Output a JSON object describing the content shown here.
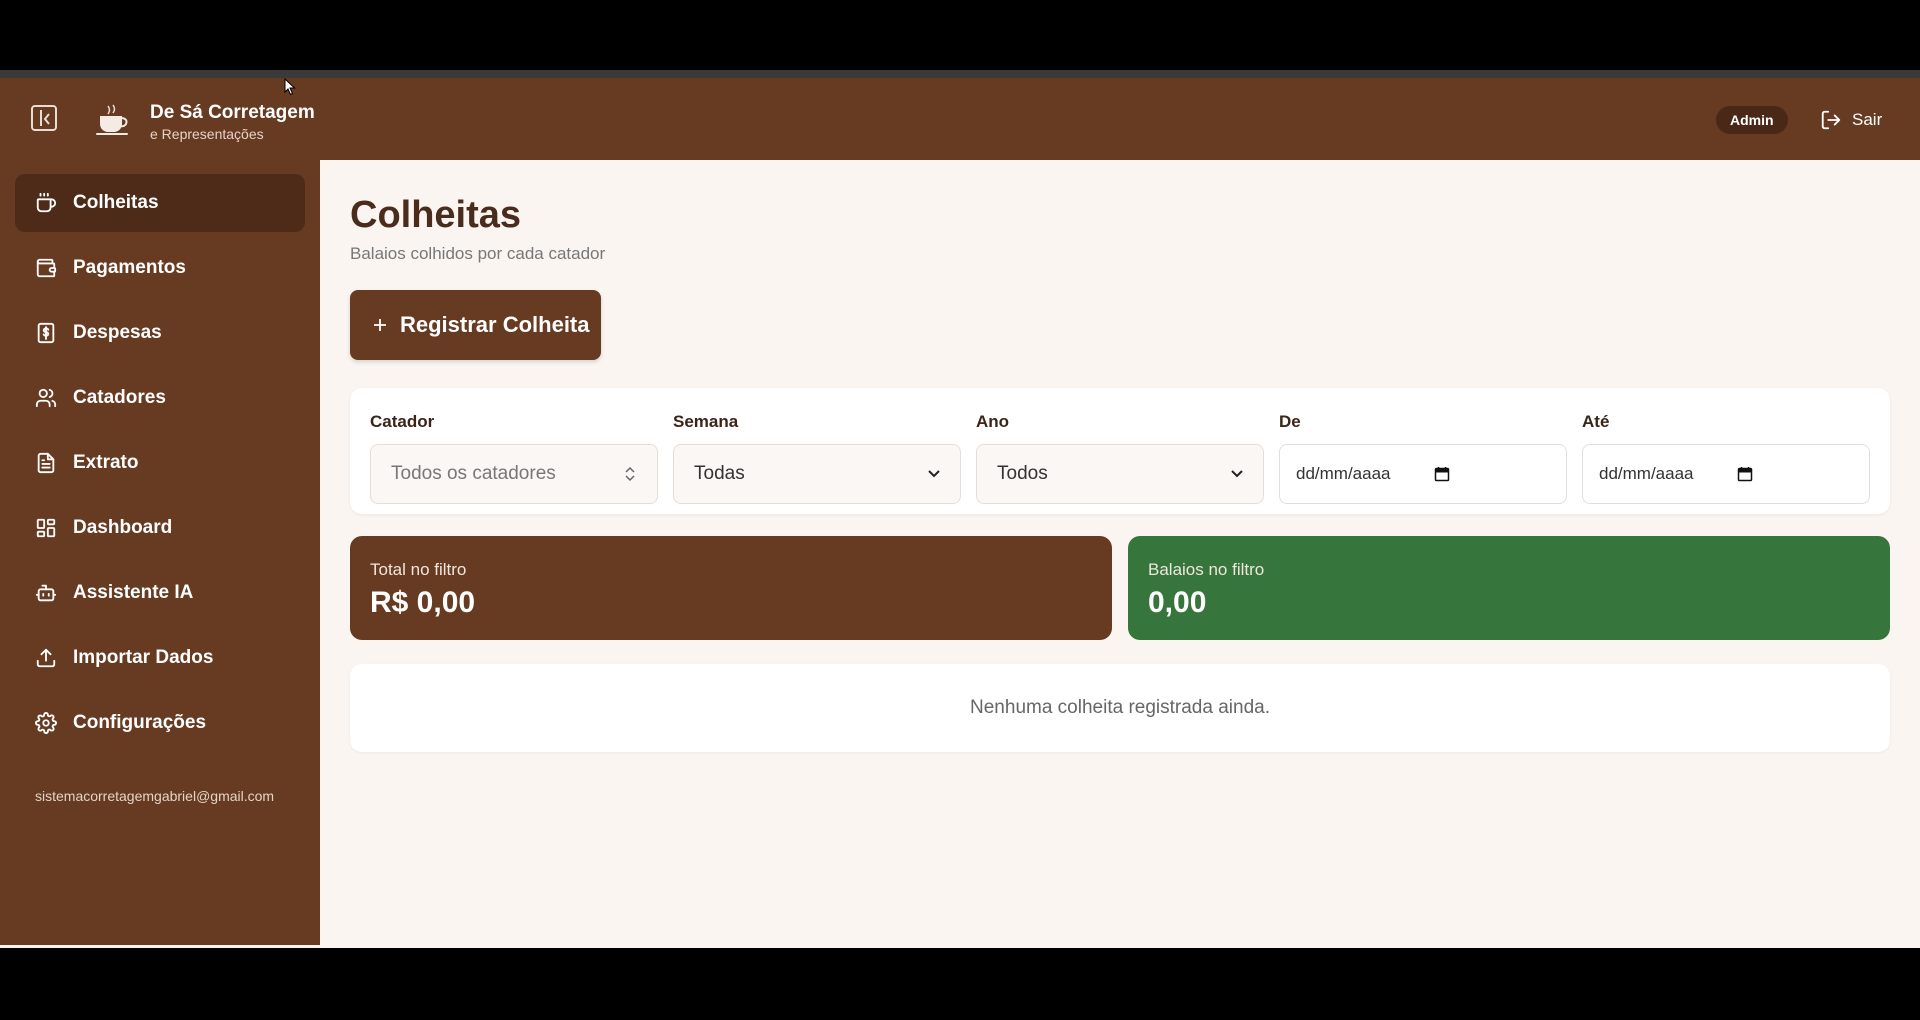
{
  "header": {
    "brand_title": "De Sá Corretagem",
    "brand_subtitle": "e Representações",
    "admin_badge": "Admin",
    "logout_label": "Sair"
  },
  "sidebar": {
    "items": [
      {
        "label": "Colheitas",
        "icon": "coffee-cup-icon",
        "active": true
      },
      {
        "label": "Pagamentos",
        "icon": "wallet-icon"
      },
      {
        "label": "Despesas",
        "icon": "receipt-dollar-icon"
      },
      {
        "label": "Catadores",
        "icon": "users-icon"
      },
      {
        "label": "Extrato",
        "icon": "document-icon"
      },
      {
        "label": "Dashboard",
        "icon": "grid-icon"
      },
      {
        "label": "Assistente IA",
        "icon": "robot-icon"
      },
      {
        "label": "Importar Dados",
        "icon": "upload-icon"
      },
      {
        "label": "Configurações",
        "icon": "gear-icon"
      }
    ],
    "email": "sistemacorretagemgabriel@gmail.com"
  },
  "main": {
    "title": "Colheitas",
    "subtitle": "Balaios colhidos por cada catador",
    "register_button": "Registrar Colheita",
    "filters": {
      "catador": {
        "label": "Catador",
        "placeholder": "Todos os catadores"
      },
      "semana": {
        "label": "Semana",
        "value": "Todas"
      },
      "ano": {
        "label": "Ano",
        "value": "Todos"
      },
      "de": {
        "label": "De",
        "placeholder": "dd/mm/aaaa"
      },
      "ate": {
        "label": "Até",
        "placeholder": "dd/mm/aaaa"
      }
    },
    "cards": {
      "total": {
        "label": "Total no filtro",
        "value": "R$ 0,00"
      },
      "balaios": {
        "label": "Balaios no filtro",
        "value": "0,00"
      }
    },
    "empty_message": "Nenhuma colheita registrada ainda."
  },
  "colors": {
    "brand_brown": "#673a22",
    "active_brown": "#4e2b18",
    "green": "#36753b",
    "background": "#fbf5f1"
  }
}
